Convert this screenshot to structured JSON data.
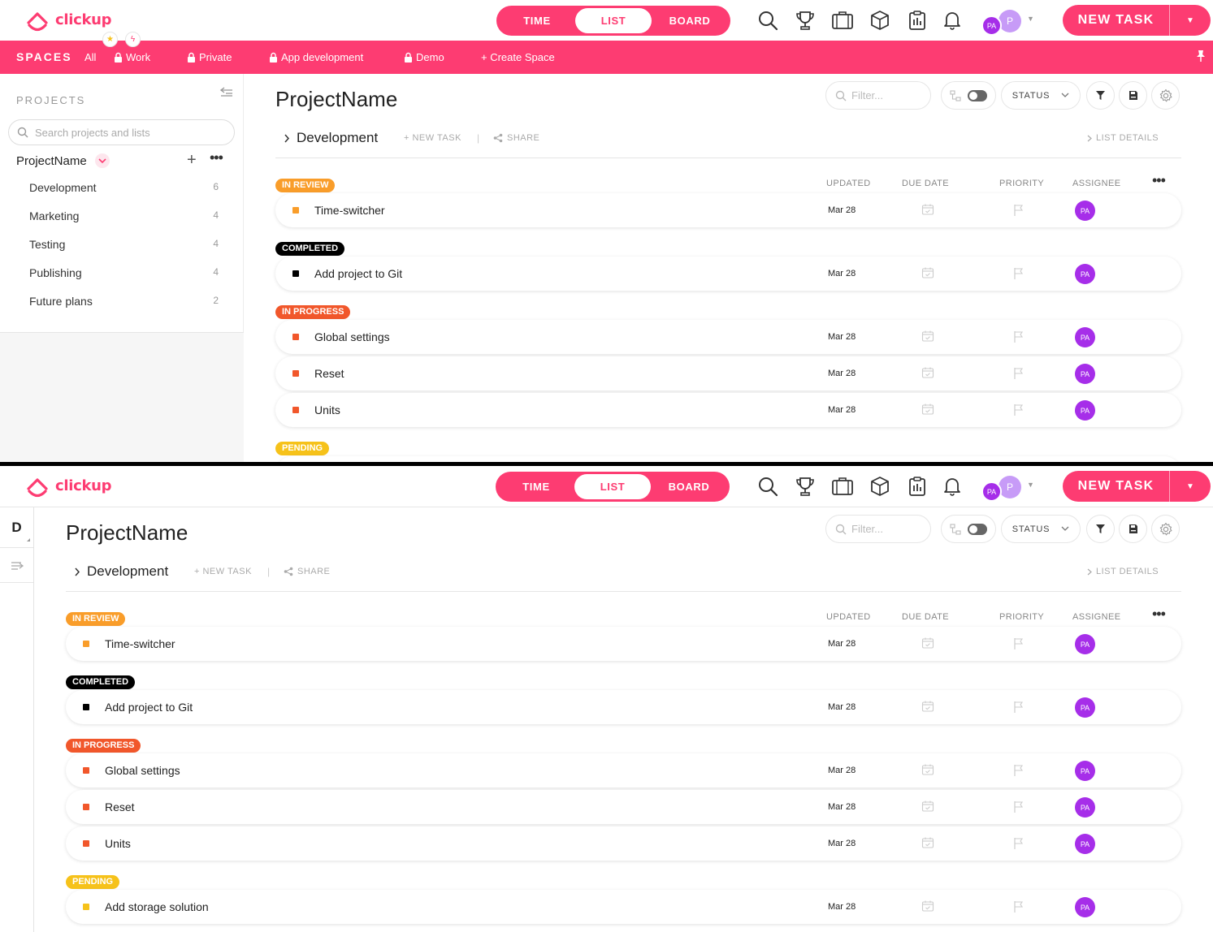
{
  "colors": {
    "brand": "#fd3c72",
    "review": "#f99d2a",
    "completed": "#000000",
    "progress": "#f1572b",
    "pending": "#f6c21a",
    "avatar": "#a62ee9"
  },
  "app": {
    "name": "clickup"
  },
  "views": {
    "time": "TIME",
    "list": "LIST",
    "board": "BOARD",
    "active": "LIST"
  },
  "toolbar_icons": [
    "search-icon",
    "trophy-icon",
    "briefcase-icon",
    "cube-icon",
    "clipboard-icon",
    "bell-icon"
  ],
  "user": {
    "initials": "PA",
    "letter": "P"
  },
  "new_task": {
    "label": "NEW TASK"
  },
  "spaces": {
    "label": "SPACES",
    "all": "All",
    "items": [
      "Work",
      "Private",
      "App development",
      "Demo"
    ],
    "create": "+ Create Space"
  },
  "sidebar": {
    "title": "PROJECTS",
    "search_placeholder": "Search projects and lists",
    "project_name": "ProjectName",
    "lists": [
      {
        "name": "Development",
        "count": "6"
      },
      {
        "name": "Marketing",
        "count": "4"
      },
      {
        "name": "Testing",
        "count": "4"
      },
      {
        "name": "Publishing",
        "count": "4"
      },
      {
        "name": "Future plans",
        "count": "2"
      }
    ]
  },
  "rail": {
    "letter": "D"
  },
  "main": {
    "title": "ProjectName",
    "filter_placeholder": "Filter...",
    "status_label": "STATUS",
    "breadcrumb": "Development",
    "new_task": "+ NEW TASK",
    "separator": "|",
    "share": "SHARE",
    "list_details": "LIST DETAILS",
    "columns": {
      "updated": "UPDATED",
      "due": "DUE DATE",
      "priority": "PRIORITY",
      "assignee": "ASSIGNEE"
    }
  },
  "groups": [
    {
      "status": "IN REVIEW",
      "color": "#f99d2a",
      "tasks": [
        {
          "name": "Time-switcher",
          "updated": "Mar 28",
          "assignee": "PA"
        }
      ]
    },
    {
      "status": "COMPLETED",
      "color": "#000000",
      "tasks": [
        {
          "name": "Add project to Git",
          "updated": "Mar 28",
          "assignee": "PA"
        }
      ]
    },
    {
      "status": "IN PROGRESS",
      "color": "#f1572b",
      "tasks": [
        {
          "name": "Global settings",
          "updated": "Mar 28",
          "assignee": "PA"
        },
        {
          "name": "Reset",
          "updated": "Mar 28",
          "assignee": "PA"
        },
        {
          "name": "Units",
          "updated": "Mar 28",
          "assignee": "PA"
        }
      ]
    },
    {
      "status": "PENDING",
      "color": "#f6c21a",
      "tasks": [
        {
          "name": "Add storage solution",
          "updated": "Mar 28",
          "assignee": "PA"
        }
      ]
    }
  ]
}
